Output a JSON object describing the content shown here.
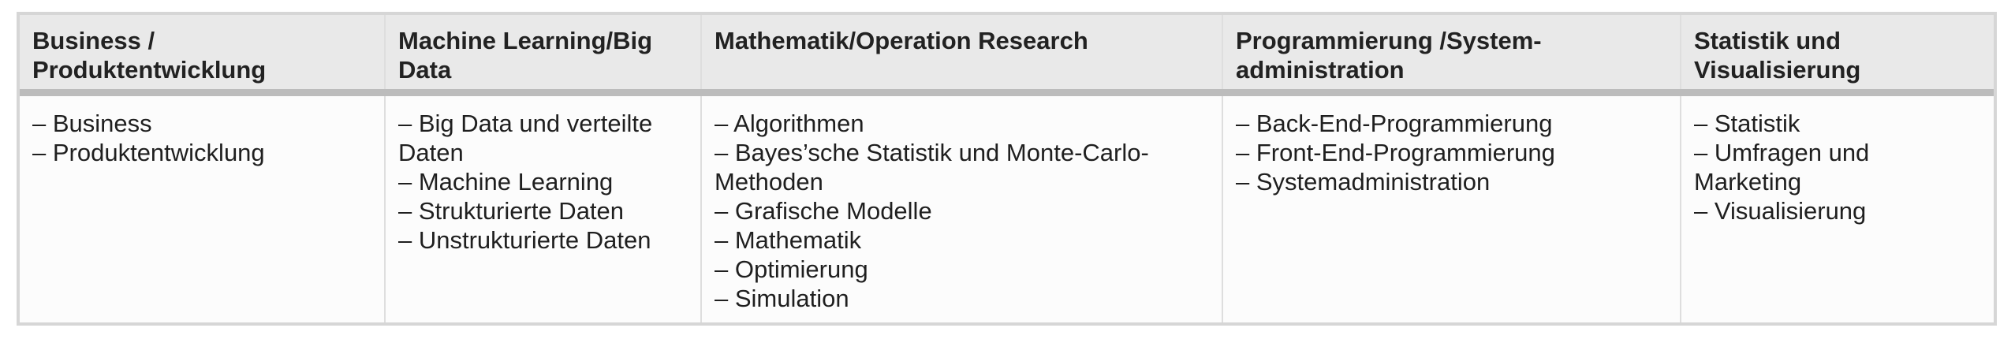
{
  "table": {
    "columns": [
      {
        "header": "Business / Produktentwicklung",
        "items": [
          "– Business",
          "– Produktentwicklung"
        ]
      },
      {
        "header": "Machine Learning/Big Data",
        "items": [
          "– Big Data und verteilte Daten",
          "– Machine Learning",
          "– Strukturierte Daten",
          "– Unstrukturierte Daten"
        ]
      },
      {
        "header": "Mathematik/Operation Research",
        "items": [
          "– Algorithmen",
          "– Bayes’sche Statistik und Monte-Carlo-Methoden",
          "– Grafische Modelle",
          "– Mathematik",
          "– Optimierung",
          "– Simulation"
        ]
      },
      {
        "header": "Programmierung /System-administration",
        "items": [
          "– Back-End-Programmierung",
          "– Front-End-Programmierung",
          "– Systemadministration"
        ]
      },
      {
        "header": "Statistik und Visualisierung",
        "items": [
          "– Statistik",
          "– Umfragen und Marketing",
          "– Visualisierung"
        ]
      }
    ]
  }
}
